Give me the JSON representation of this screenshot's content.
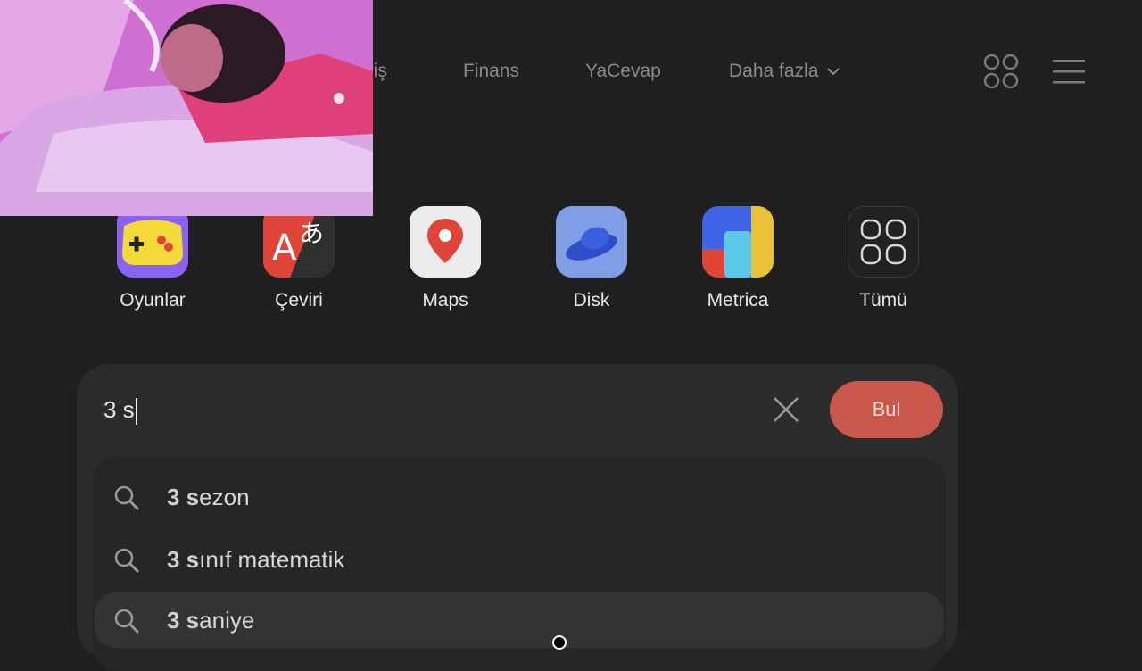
{
  "nav": {
    "items": [
      "eriş",
      "Finans",
      "YaCevap",
      "Daha fazla"
    ]
  },
  "services": [
    {
      "label": "Oyunlar",
      "icon": "gamepad-icon"
    },
    {
      "label": "Çeviri",
      "icon": "translate-icon"
    },
    {
      "label": "Maps",
      "icon": "map-pin-icon"
    },
    {
      "label": "Disk",
      "icon": "disk-ufo-icon"
    },
    {
      "label": "Metrica",
      "icon": "metrica-icon"
    },
    {
      "label": "Tümü",
      "icon": "grid-icon"
    }
  ],
  "search": {
    "value": "3 s",
    "button": "Bul",
    "suggestions": [
      {
        "bold": "3 s",
        "rest": "ezon"
      },
      {
        "bold": "3 s",
        "rest": "ınıf matematik"
      },
      {
        "bold": "3 s",
        "rest": "aniye"
      }
    ]
  },
  "colors": {
    "background": "#1f1f1f",
    "find_button": "#c9574c"
  }
}
